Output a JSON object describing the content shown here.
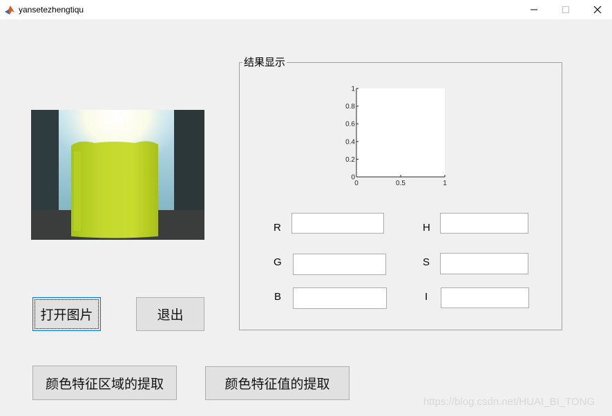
{
  "window": {
    "title": "yansetezhengtiqu",
    "icon": "matlab-icon",
    "controls": [
      "minimize-icon",
      "maximize-icon",
      "close-icon"
    ]
  },
  "buttons": {
    "open_image": "打开图片",
    "exit": "退出",
    "extract_region": "颜色特征区域的提取",
    "extract_values": "颜色特征值的提取"
  },
  "result_panel": {
    "title": "结果显示"
  },
  "chart_data": {
    "type": "line",
    "series": [],
    "xlim": [
      0,
      1
    ],
    "ylim": [
      0,
      1
    ],
    "xticks": [
      "0",
      "0.5",
      "1"
    ],
    "yticks": [
      "0",
      "0.2",
      "0.4",
      "0.6",
      "0.8",
      "1"
    ],
    "grid": false
  },
  "fields": {
    "R": {
      "label": "R",
      "value": ""
    },
    "G": {
      "label": "G",
      "value": ""
    },
    "B": {
      "label": "B",
      "value": ""
    },
    "H": {
      "label": "H",
      "value": ""
    },
    "S": {
      "label": "S",
      "value": ""
    },
    "I": {
      "label": "I",
      "value": ""
    }
  },
  "watermark": "https://blog.csdn.net/HUAI_BI_TONG"
}
